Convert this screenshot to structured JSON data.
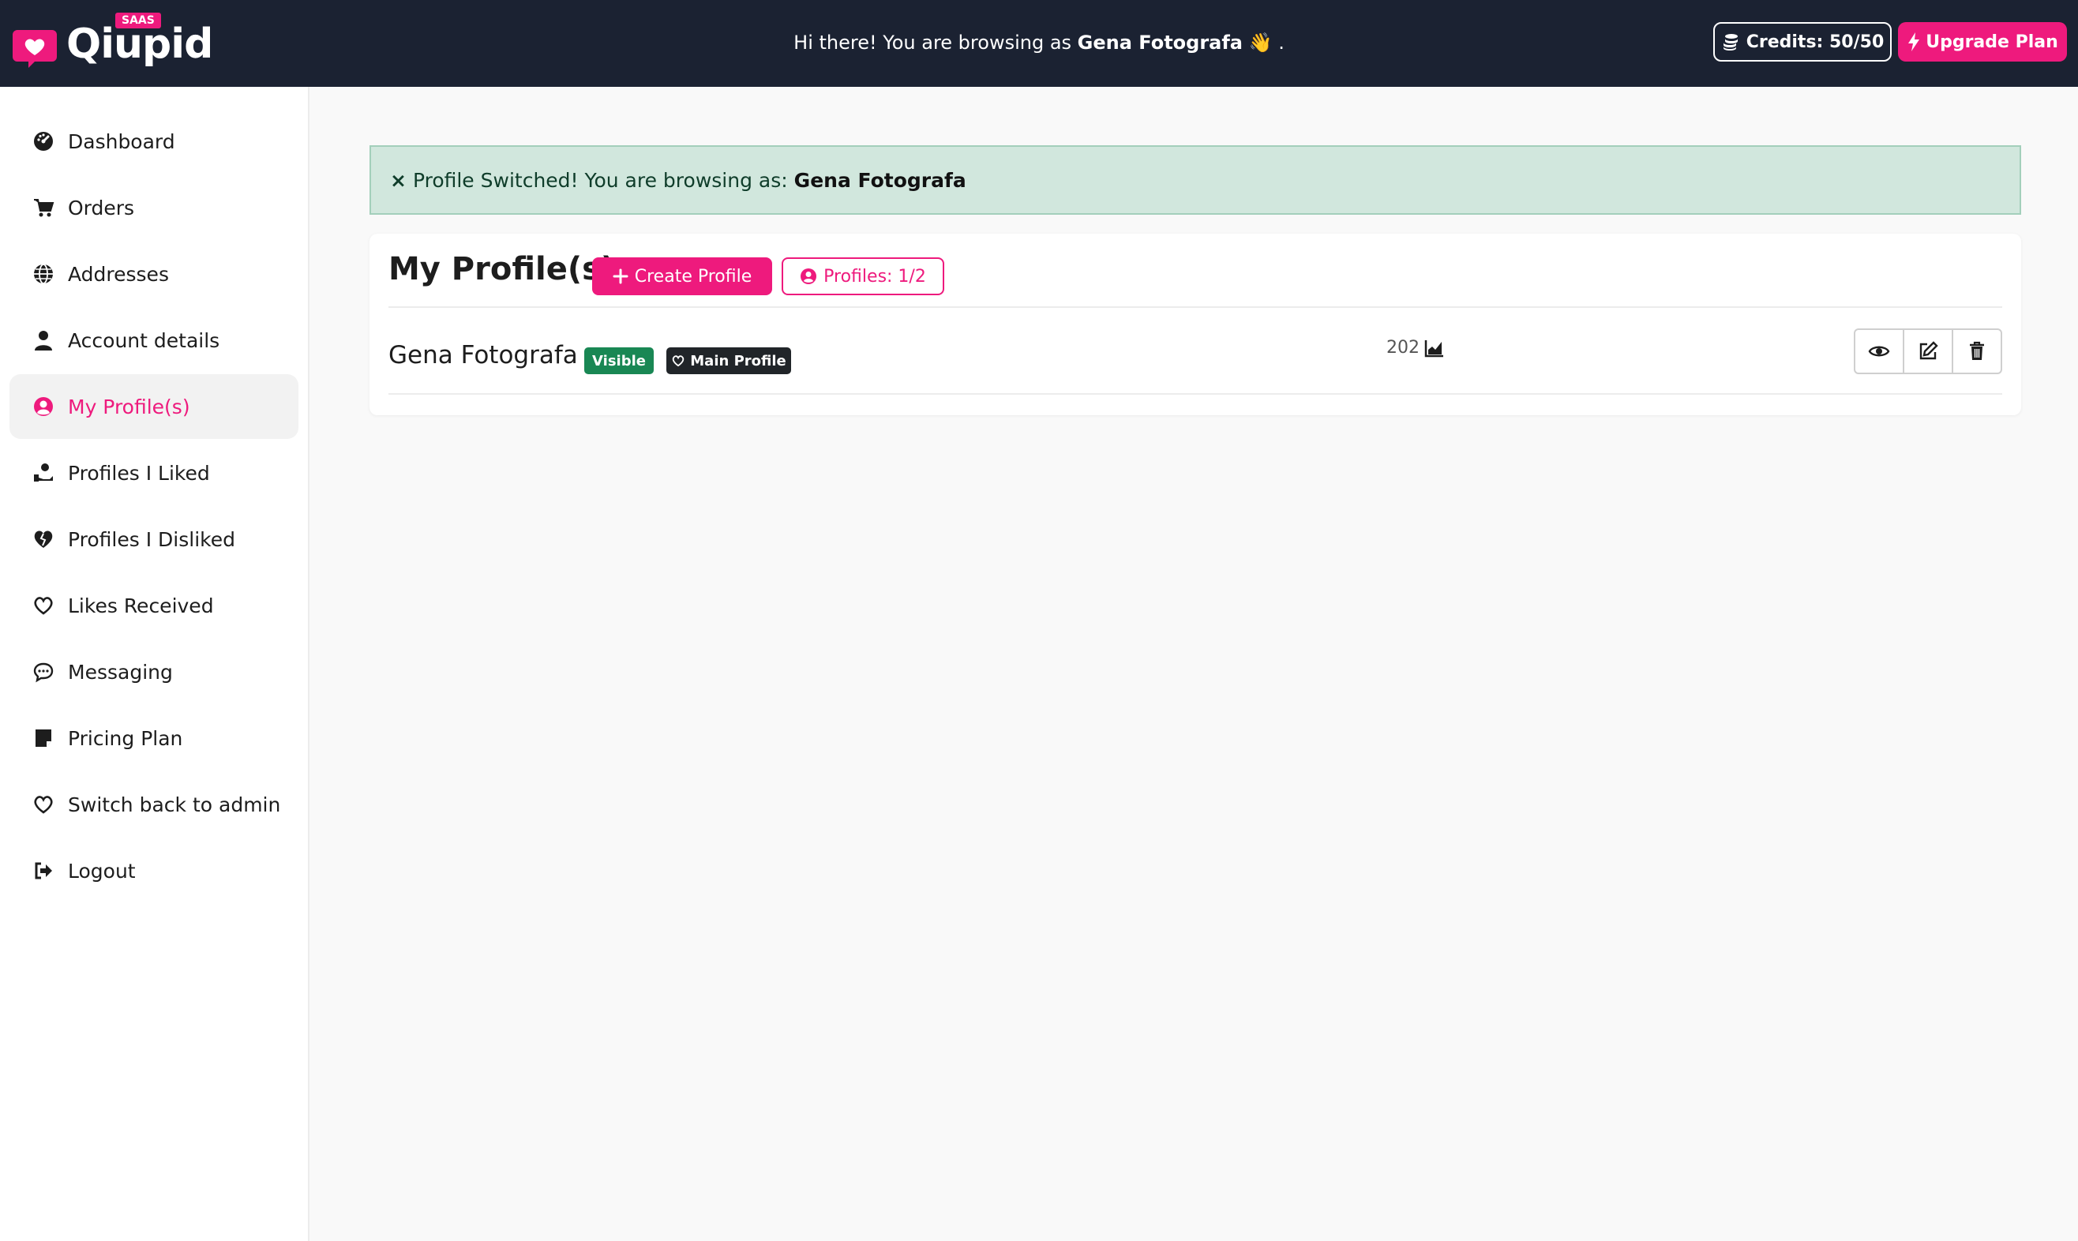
{
  "app": {
    "brand": "Qiupid",
    "badge": "SAAS"
  },
  "header": {
    "greeting_prefix": "Hi there! You are browsing as",
    "greeting_name": "Gena Fotografa",
    "greeting_emoji": "👋",
    "greeting_suffix": ".",
    "credits_label": "Credits: 50/50",
    "upgrade_label": "Upgrade Plan"
  },
  "sidebar": {
    "items": [
      {
        "label": "Dashboard",
        "icon": "gauge-icon"
      },
      {
        "label": "Orders",
        "icon": "cart-icon"
      },
      {
        "label": "Addresses",
        "icon": "globe-icon"
      },
      {
        "label": "Account details",
        "icon": "user-icon"
      },
      {
        "label": "My Profile(s)",
        "icon": "user-circle-icon",
        "active": true
      },
      {
        "label": "Profiles I Liked",
        "icon": "hand-holding-heart-icon"
      },
      {
        "label": "Profiles I Disliked",
        "icon": "heart-broken-icon"
      },
      {
        "label": "Likes Received",
        "icon": "heart-outline-icon"
      },
      {
        "label": "Messaging",
        "icon": "chat-icon"
      },
      {
        "label": "Pricing Plan",
        "icon": "note-icon"
      },
      {
        "label": "Switch back to admin",
        "icon": "heart-outline-icon"
      },
      {
        "label": "Logout",
        "icon": "logout-icon"
      }
    ]
  },
  "alert": {
    "close": "×",
    "message": "Profile Switched! You are browsing as:",
    "name": "Gena Fotografa"
  },
  "profiles": {
    "title": "My Profile(s)",
    "create_label": "Create Profile",
    "count_label": "Profiles: 1/2",
    "rows": [
      {
        "name": "Gena Fotografa",
        "visibility": "Visible",
        "main_label": "Main Profile",
        "views": "202"
      }
    ]
  },
  "colors": {
    "brand": "#ee1a7d",
    "header_bg": "#1b2232",
    "success": "#198754",
    "alert_bg": "#d1e7dd"
  }
}
